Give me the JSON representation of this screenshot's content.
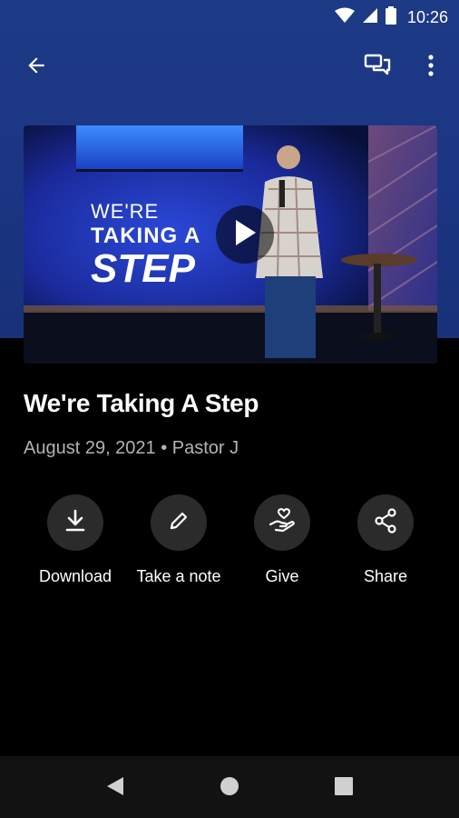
{
  "status_bar": {
    "time": "10:26"
  },
  "app_bar": {
    "back_icon": "arrow-left-icon",
    "chat_icon": "chat-bubbles-icon",
    "more_icon": "more-vertical-icon"
  },
  "video": {
    "overlay_line1": "WE'RE",
    "overlay_line2": "TAKING A",
    "overlay_line3": "STEP",
    "play_icon": "play-icon"
  },
  "sermon": {
    "title": "We're Taking A Step",
    "meta": "August 29, 2021 • Pastor J"
  },
  "actions": [
    {
      "label": "Download",
      "icon": "download-icon"
    },
    {
      "label": "Take a note",
      "icon": "pencil-icon"
    },
    {
      "label": "Give",
      "icon": "hand-heart-icon"
    },
    {
      "label": "Share",
      "icon": "share-icon"
    }
  ],
  "colors": {
    "header_blue": "#1d3a86",
    "background": "#000000",
    "button_bg": "#2b2b2b",
    "meta_gray": "#b3b3b3"
  }
}
